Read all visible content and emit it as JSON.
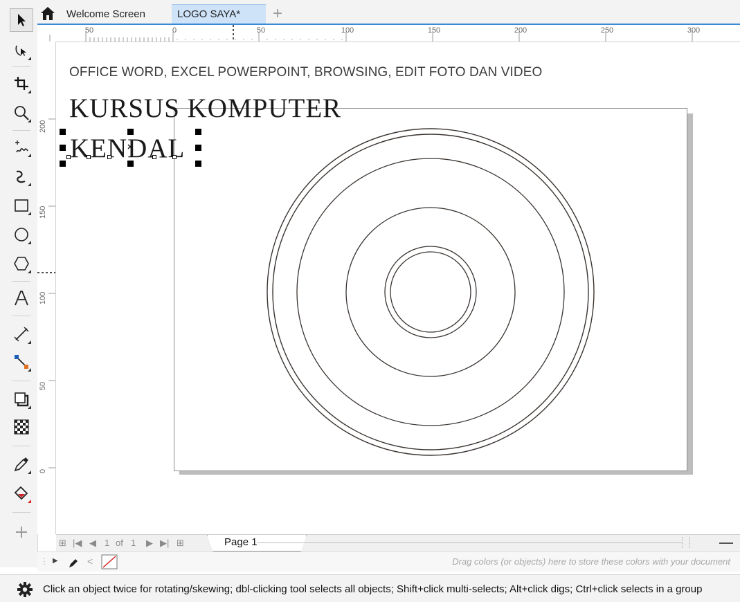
{
  "tabs": {
    "welcome": "Welcome Screen",
    "active": "LOGO SAYA*",
    "add": "+"
  },
  "ruler": {
    "horizontal_labels": [
      "50",
      "0",
      "50",
      "100",
      "150",
      "200",
      "250",
      "300"
    ],
    "vertical_labels": [
      "200",
      "150",
      "100",
      "50",
      "0"
    ]
  },
  "canvas": {
    "line1": "OFFICE WORD, EXCEL POWERPOINT, BROWSING, EDIT FOTO DAN VIDEO",
    "line2": "KURSUS KOMPUTER",
    "line3": "KENDAL"
  },
  "page_nav": {
    "current": "1",
    "of": "of",
    "total": "1",
    "page_tab": "Page 1"
  },
  "palette": {
    "hint": "Drag colors (or objects) here to store these colors with your document"
  },
  "status": {
    "text": "Click an object twice for rotating/skewing; dbl-clicking tool selects all objects; Shift+click multi-selects; Alt+click digs; Ctrl+click selects in a group"
  },
  "toolbox_icons": [
    "pick-tool",
    "shape-tool",
    "crop-tool",
    "zoom-tool",
    "freehand-tool",
    "artistic-media-tool",
    "rectangle-tool",
    "ellipse-tool",
    "polygon-tool",
    "text-tool",
    "dimension-tool",
    "connector-tool",
    "drop-shadow-tool",
    "transparency-tool",
    "eyedropper-tool",
    "interactive-fill-tool",
    "add-tool"
  ],
  "colors": {
    "accent": "#3a8ad8",
    "active_tab": "#cfe3f8"
  }
}
